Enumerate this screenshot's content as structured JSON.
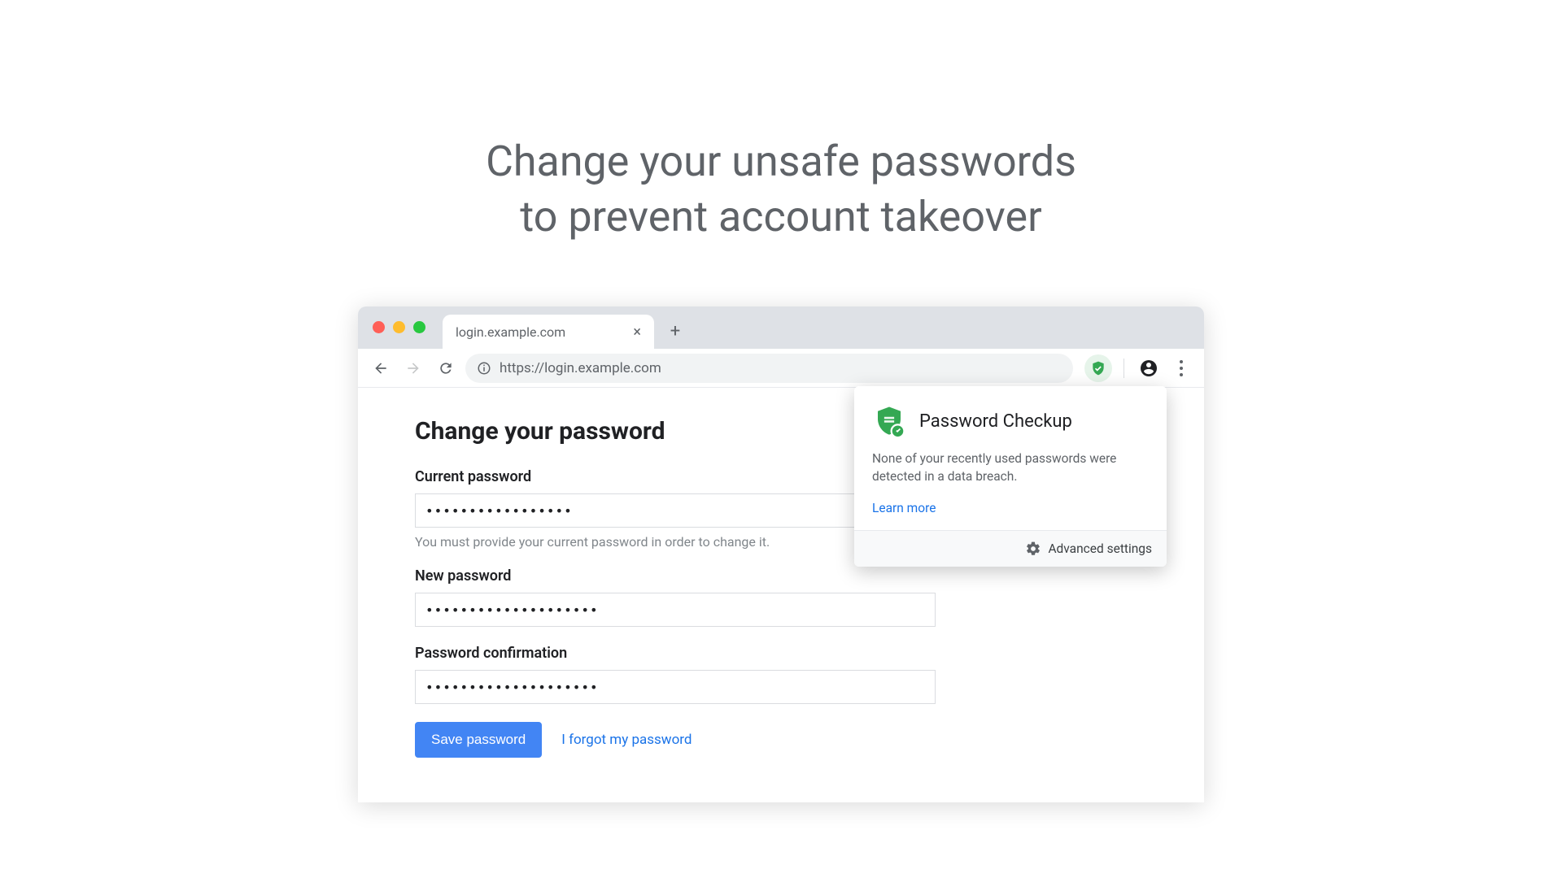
{
  "headline": "Change your unsafe passwords\nto prevent account takeover",
  "tab": {
    "title": "login.example.com"
  },
  "omnibox": {
    "url": "https://login.example.com"
  },
  "page": {
    "heading": "Change your password",
    "current": {
      "label": "Current password",
      "value": "•••••••••••••••••",
      "hint": "You must provide your current password in order to change it."
    },
    "new": {
      "label": "New password",
      "value": "••••••••••••••••••••"
    },
    "confirm": {
      "label": "Password confirmation",
      "value": "••••••••••••••••••••"
    },
    "save_label": "Save password",
    "forgot_label": "I forgot my password"
  },
  "popup": {
    "title": "Password Checkup",
    "body": "None of your recently used passwords were detected in a data breach.",
    "learn_more": "Learn more",
    "advanced": "Advanced settings"
  }
}
